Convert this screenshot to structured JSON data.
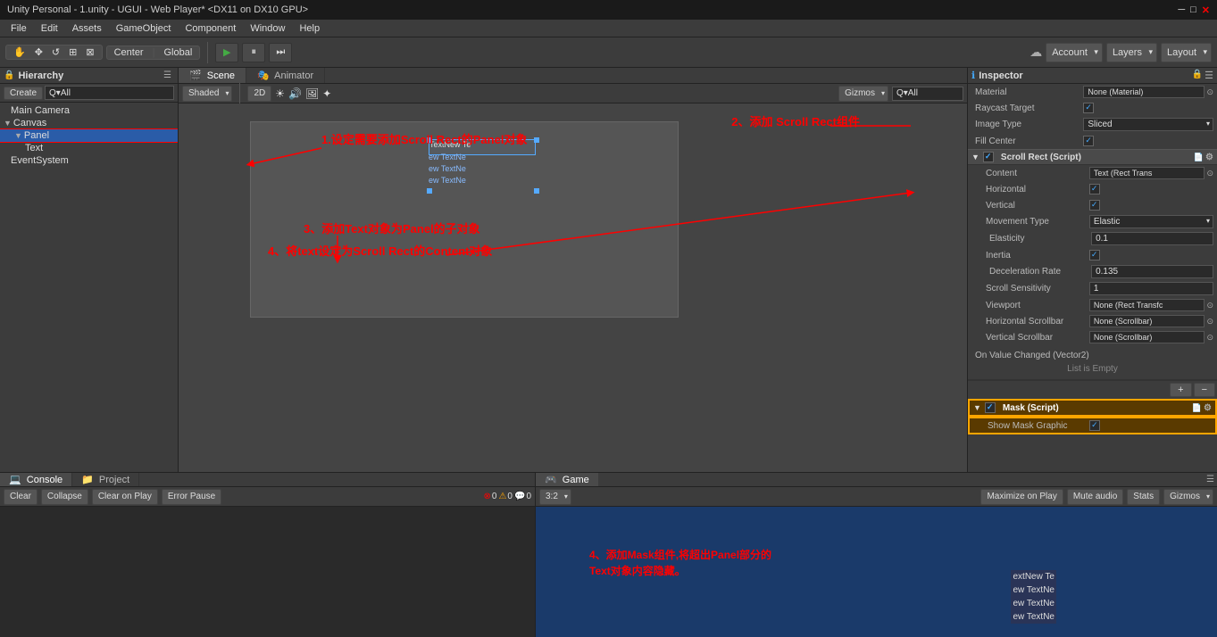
{
  "titlebar": {
    "text": "Unity Personal - 1.unity - UGUI - Web Player* <DX11 on DX10 GPU>"
  },
  "menubar": {
    "items": [
      "File",
      "Edit",
      "Assets",
      "GameObject",
      "Component",
      "Window",
      "Help"
    ]
  },
  "toolbar": {
    "transform_tools": [
      "⊕",
      "↔",
      "↺",
      "⊞",
      "⊠"
    ],
    "center_label": "Center",
    "global_label": "Global",
    "play_btn": "▶",
    "pause_btn": "⏸",
    "step_btn": "⏭",
    "cloud_icon": "☁",
    "account_label": "Account",
    "layers_label": "Layers",
    "layout_label": "Layout"
  },
  "hierarchy": {
    "title": "Hierarchy",
    "create_label": "Create",
    "search_placeholder": "Q▾All",
    "items": [
      {
        "label": "Main Camera",
        "indent": 0
      },
      {
        "label": "Canvas",
        "indent": 0,
        "expanded": true
      },
      {
        "label": "Panel",
        "indent": 1,
        "selected": true
      },
      {
        "label": "Text",
        "indent": 2
      },
      {
        "label": "EventSystem",
        "indent": 0
      }
    ]
  },
  "scene": {
    "tabs": [
      {
        "label": "Scene",
        "active": true
      },
      {
        "label": "Animator",
        "active": false
      }
    ],
    "toolbar": {
      "shaded_label": "Shaded",
      "twod_label": "2D",
      "gizmos_label": "Gizmos",
      "search_placeholder": "Q▾All"
    }
  },
  "annotations": {
    "ann1": "1.设定需要添加Scroll Rect的Panel对象",
    "ann2": "2、添加 Scroll Rect组件",
    "ann3": "3、添加Text对象为Panel的子对象",
    "ann4": "4、将text设定为Scroll Rect的Content对象",
    "ann5": "4、添加Mask组件,将超出Panel部分的\nText对象内容隐藏。"
  },
  "inspector": {
    "title": "Inspector",
    "material_label": "Material",
    "material_value": "None (Material)",
    "raycast_label": "Raycast Target",
    "image_type_label": "Image Type",
    "image_type_value": "Sliced",
    "fill_center_label": "Fill Center",
    "scroll_rect_section": "Scroll Rect (Script)",
    "content_label": "Content",
    "content_value": "Text (Rect Trans",
    "horizontal_label": "Horizontal",
    "vertical_label": "Vertical",
    "movement_label": "Movement Type",
    "movement_value": "Elastic",
    "elasticity_label": "Elasticity",
    "elasticity_value": "0.1",
    "inertia_label": "Inertia",
    "decel_label": "Deceleration Rate",
    "decel_value": "0.135",
    "scroll_sens_label": "Scroll Sensitivity",
    "scroll_sens_value": "1",
    "viewport_label": "Viewport",
    "viewport_value": "None (Rect Transfc",
    "h_scrollbar_label": "Horizontal Scrollbar",
    "h_scrollbar_value": "None (Scrollbar)",
    "v_scrollbar_label": "Vertical Scrollbar",
    "v_scrollbar_value": "None (Scrollbar)",
    "on_value_changed_label": "On Value Changed (Vector2)",
    "list_empty_label": "List is Empty",
    "mask_section": "Mask (Script)",
    "show_mask_label": "Show Mask Graphic"
  },
  "console": {
    "tabs": [
      {
        "label": "Console",
        "active": true
      },
      {
        "label": "Project",
        "active": false
      }
    ],
    "toolbar": {
      "clear_label": "Clear",
      "collapse_label": "Collapse",
      "clear_on_play_label": "Clear on Play",
      "error_pause_label": "Error Pause"
    },
    "icons": {
      "errors": "0",
      "warnings": "0",
      "messages": "0"
    }
  },
  "game": {
    "tabs": [
      {
        "label": "Game",
        "active": true
      }
    ],
    "toolbar": {
      "ratio_label": "3:2",
      "maximize_label": "Maximize on Play",
      "mute_label": "Mute audio",
      "stats_label": "Stats",
      "gizmos_label": "Gizmos"
    },
    "game_text_objects": [
      "extNew Te",
      "ew TextNe",
      "ew TextNe",
      "ew TextNe"
    ]
  }
}
